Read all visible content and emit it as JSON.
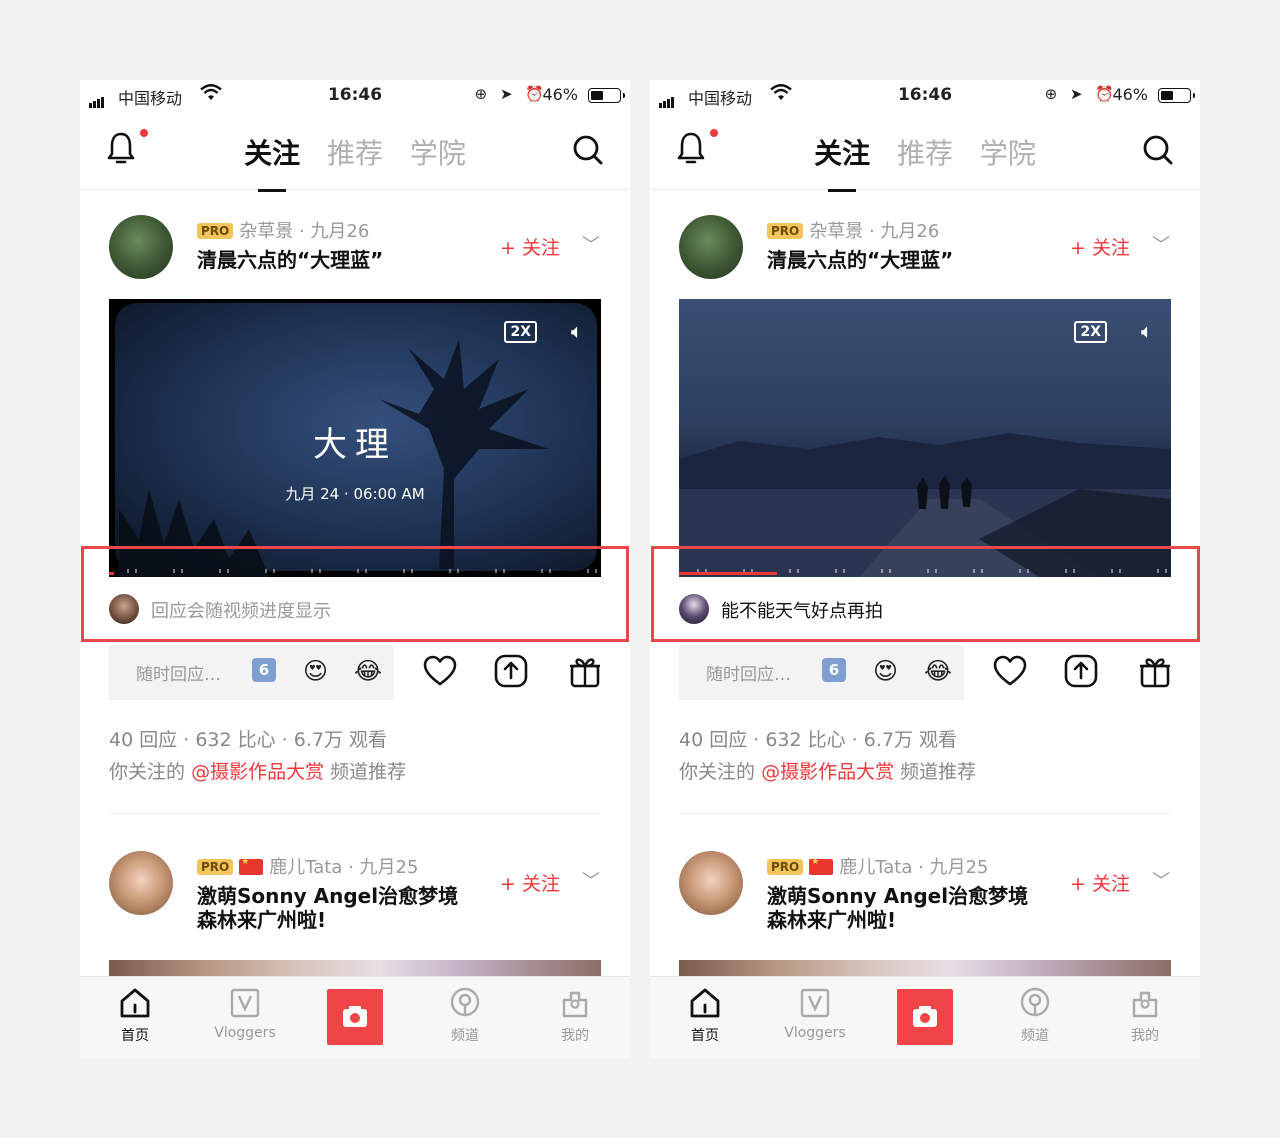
{
  "status": {
    "carrier": "中国移动",
    "time": "16:46",
    "battery": "46%",
    "battery_level": 0.46
  },
  "header": {
    "tabs": [
      "关注",
      "推荐",
      "学院"
    ],
    "active_tab": 0
  },
  "posts": [
    {
      "badge": "PRO",
      "meta": "杂草景 · 九月26",
      "title": "清晨六点的“大理蓝”",
      "follow": "+ 关注"
    },
    {
      "badge": "PRO",
      "meta": "鹿儿Tata · 九月25",
      "title": "激萌Sonny Angel治愈梦境森林来广州啦!",
      "follow": "+ 关注"
    }
  ],
  "video": {
    "speed": "2X",
    "title": "大理",
    "date": "九月 24 · 06:00 AM"
  },
  "screens": [
    {
      "comment": "回应会随视频进度显示",
      "progress": 0.01
    },
    {
      "comment": "能不能天气好点再拍",
      "progress": 0.2
    }
  ],
  "reply": {
    "placeholder": "随时回应…",
    "emoji_6": "6"
  },
  "stats": "40 回应 · 632 比心 · 6.7万 观看",
  "recommend": {
    "prefix": "你关注的",
    "channel": "@摄影作品大赏",
    "suffix": "频道推荐"
  },
  "tabbar": {
    "home": "首页",
    "vloggers": "Vloggers",
    "channel": "频道",
    "mine": "我的"
  },
  "colors": {
    "accent": "#f0383c",
    "highlight": "#e8474b"
  }
}
